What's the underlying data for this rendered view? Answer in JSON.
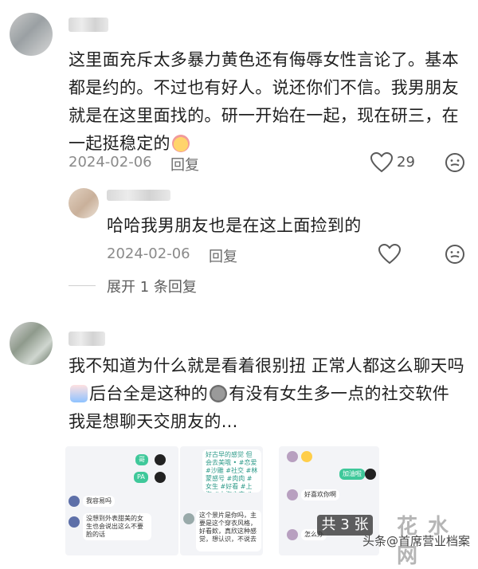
{
  "comment1": {
    "text_lines": [
      "这里面充斥太多暴力黄色还有侮辱女性言论了。基本",
      "都是约的。不过也有好人。说还你们不信。我男朋友",
      "就是在这里面找的。研一开始在一起，现在研三，在",
      "一起挺稳定的"
    ],
    "emoji_icon": "crying-laugh-emoji-icon",
    "date": "2024-02-06",
    "reply_label": "回复",
    "like_count": "29"
  },
  "reply1": {
    "text": "哈哈我男朋友也是在这上面捡到的",
    "date": "2024-02-06",
    "reply_label": "回复"
  },
  "expand": {
    "label": "展开 1 条回复"
  },
  "comment2": {
    "line1": "我不知道为什么就是看着很别扭 正常人都这么聊天吗",
    "line2_a": "后台全是这种的",
    "line2_b": "有没有女生多一点的社交软件",
    "line3": "我是想聊天交朋友的...",
    "emoji1_icon": "sticker-emoji-icon",
    "emoji2_icon": "gray-face-emoji-icon"
  },
  "screenshots": {
    "left_thumb": {
      "bubble_a": "哥",
      "bubble_b": "PA",
      "msg1": "我容易吗",
      "msg2": "没想到外表甜美的女生也会说出这么不要脸的话"
    },
    "mid_thumb": {
      "msg_top": "好古早的感觉 但会去美哦 • #恋爱 #沙雕 #社交 #林蒙感号 #肉肉 #女生 #好看 #上海 #上海之恋 #魔都",
      "msg_bottom": "这个景片是你吗，主要是这个穿衣风格，好看欸，真欣这种感觉，想认识，不说去"
    },
    "right_thumb": {
      "bubble_green": "加油啦",
      "msg1": "好喜欢你啊",
      "msg2": "怎么办"
    },
    "count_badge": "共 3 张"
  },
  "watermark": {
    "left_text": "头条",
    "mid_text": "@首席营业档案",
    "logo_text": "花 水 网"
  },
  "colors": {
    "meta_gray": "#8a8a8a",
    "divider": "#e5e5e5",
    "badge_bg": "#4a4a4a",
    "chat_green": "#3fc89a"
  }
}
